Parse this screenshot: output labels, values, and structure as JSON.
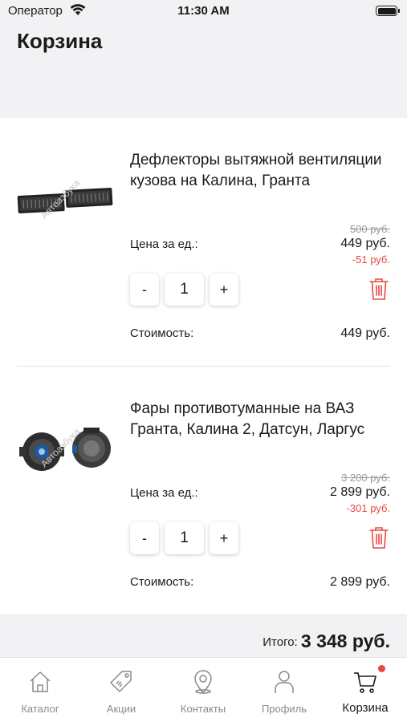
{
  "status_bar": {
    "carrier": "Оператор",
    "time": "11:30 AM"
  },
  "page": {
    "title": "Корзина"
  },
  "items": [
    {
      "name": "Дефлекторы вытяжной вентиляции кузова на Калина, Гранта",
      "price_label": "Цена за ед.:",
      "old_price": "500 руб.",
      "price": "449 руб.",
      "discount": "-51 руб.",
      "quantity": "1",
      "minus": "-",
      "plus": "+",
      "cost_label": "Стоимость:",
      "cost": "449 руб.",
      "watermark": "Автоазбука"
    },
    {
      "name": "Фары противотуманные на ВАЗ Гранта, Калина 2, Датсун, Ларгус",
      "price_label": "Цена за ед.:",
      "old_price": "3 200 руб.",
      "price": "2 899 руб.",
      "discount": "-301 руб.",
      "quantity": "1",
      "minus": "-",
      "plus": "+",
      "cost_label": "Стоимость:",
      "cost": "2 899 руб.",
      "watermark": "Автоазбука"
    }
  ],
  "total": {
    "label": "Итого:",
    "value": "3 348 руб."
  },
  "tabs": [
    {
      "label": "Каталог",
      "icon": "house-icon"
    },
    {
      "label": "Акции",
      "icon": "price-tag-icon"
    },
    {
      "label": "Контакты",
      "icon": "map-pin-icon"
    },
    {
      "label": "Профиль",
      "icon": "person-icon"
    },
    {
      "label": "Корзина",
      "icon": "cart-icon",
      "active": true
    }
  ],
  "colors": {
    "accent_red": "#e9483f",
    "muted_gray": "#8a8a8e",
    "background": "#f2f2f4"
  }
}
